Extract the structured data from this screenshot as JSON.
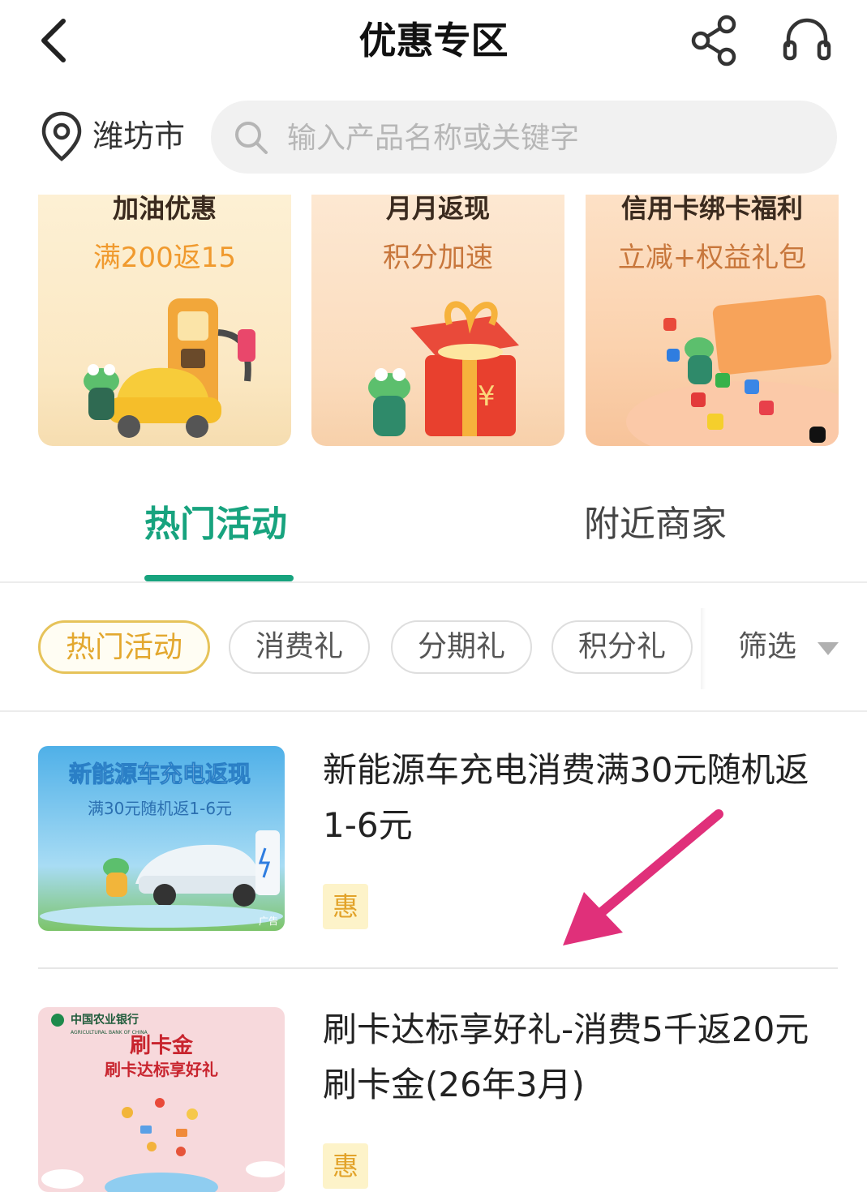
{
  "header": {
    "title": "优惠专区"
  },
  "location": {
    "city": "潍坊市"
  },
  "search": {
    "placeholder": "输入产品名称或关键字",
    "value": ""
  },
  "promos": [
    {
      "title": "加油优惠",
      "subtitle": "满200返15"
    },
    {
      "title": "月月返现",
      "subtitle": "积分加速"
    },
    {
      "title": "信用卡绑卡福利",
      "subtitle": "立减+权益礼包"
    }
  ],
  "tabs": [
    {
      "label": "热门活动",
      "active": true
    },
    {
      "label": "附近商家",
      "active": false
    }
  ],
  "chips": [
    {
      "label": "热门活动",
      "selected": true
    },
    {
      "label": "消费礼",
      "selected": false
    },
    {
      "label": "分期礼",
      "selected": false
    },
    {
      "label": "积分礼",
      "selected": false
    }
  ],
  "filter": {
    "label": "筛选"
  },
  "items": [
    {
      "title": "新能源车充电消费满30元随机返1-6元",
      "badge": "惠",
      "thumb": {
        "headline": "新能源车充电返现",
        "subline": "满30元随机返1-6元",
        "tag": "广告"
      }
    },
    {
      "title": "刷卡达标享好礼-消费5千返20元刷卡金(26年3月)",
      "badge": "惠",
      "thumb": {
        "bank": "中国农业银行",
        "bank_en": "AGRICULTURAL BANK OF CHINA",
        "headline": "刷卡金",
        "subline": "刷卡达标享好礼"
      }
    }
  ],
  "colors": {
    "accent_green": "#17a37e",
    "chip_gold": "#e3a82f",
    "annotation_pink": "#e0307a"
  }
}
